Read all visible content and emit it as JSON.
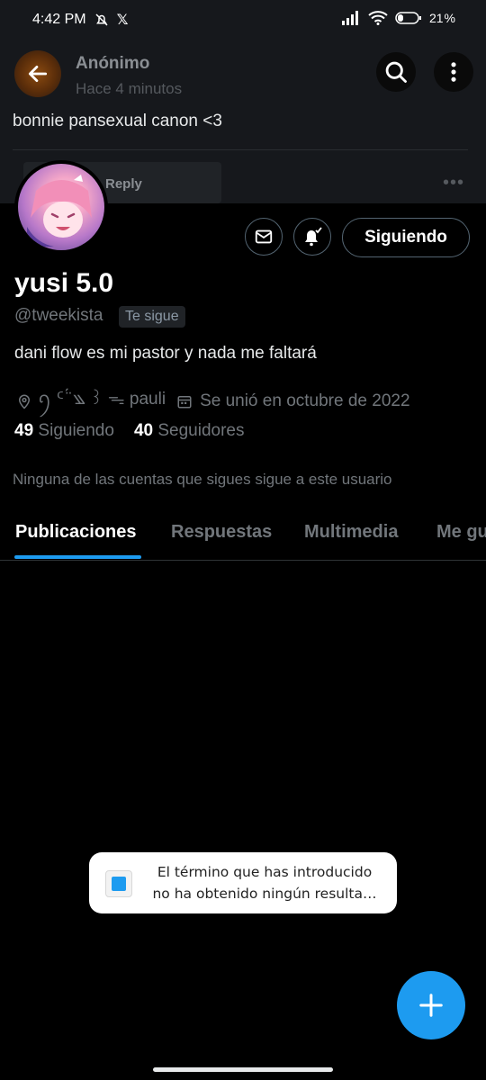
{
  "status_bar": {
    "time": "4:42 PM",
    "x_logo": "𝕏",
    "battery": "21"
  },
  "banner": {
    "author": "Anónimo",
    "time": "Hace 4 minutos",
    "text": "bonnie pansexual canon <3",
    "reply_label": "Reply"
  },
  "profile": {
    "display_name": "yusi 5.0",
    "handle": "@tweekista",
    "follows_you": "Te sigue",
    "bio": "dani flow es mi pastor y nada me faltará",
    "location": "ꪆ ᑦ ̈́ ꧉ ꒱ ᯓ pauli",
    "joined": "Se unió en octubre de 2022",
    "following_count": "49",
    "following_label": "Siguiendo",
    "followers_count": "40",
    "followers_label": "Seguidores",
    "follow_button": "Siguiendo",
    "mutuals_note": "Ninguna de las cuentas que sigues sigue a este usuario"
  },
  "tabs": [
    "Publicaciones",
    "Respuestas",
    "Multimedia",
    "Me gu"
  ],
  "toast": {
    "text": "El término que has introducido no ha obtenido ningún resulta…"
  },
  "colors": {
    "accent": "#1d9bf0",
    "background": "#000000",
    "muted": "#71767b"
  },
  "icons": [
    "back-arrow-icon",
    "search-icon",
    "more-icon",
    "message-icon",
    "notification-bell-icon",
    "location-icon",
    "calendar-icon",
    "compose-plus-icon",
    "twitter-icon"
  ]
}
